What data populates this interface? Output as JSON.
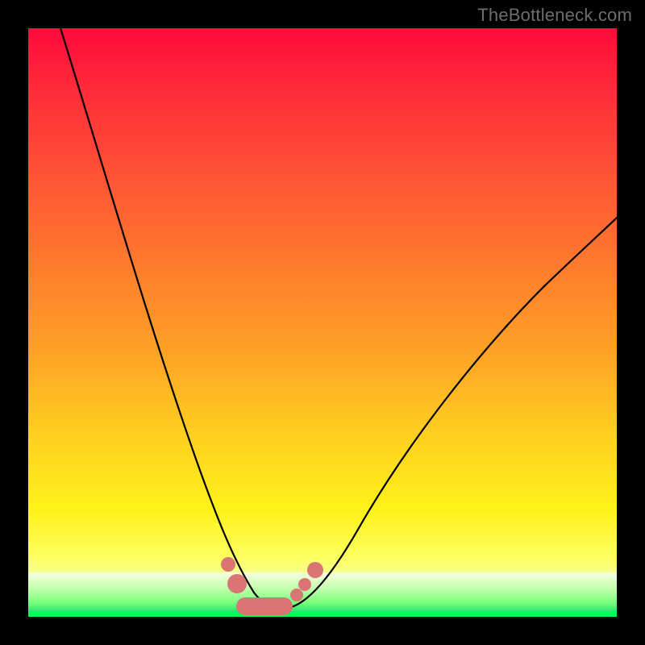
{
  "watermark": "TheBottleneck.com",
  "colors": {
    "background_black": "#000000",
    "gradient_top": "#ff0a3c",
    "gradient_mid": "#ffd21f",
    "gradient_bottom_yellow": "#fcff60",
    "green_band_light": "#f6ffe0",
    "green_band_vivid": "#00ff55",
    "curve_stroke": "#000000",
    "marker_fill": "#d97575",
    "watermark_text": "#6d6d6d"
  },
  "chart_data": {
    "type": "line",
    "title": "",
    "xlabel": "",
    "ylabel": "",
    "xlim": [
      0,
      100
    ],
    "ylim": [
      0,
      100
    ],
    "grid": false,
    "legend": false,
    "series": [
      {
        "name": "bottleneck-curve",
        "x": [
          5,
          10,
          15,
          20,
          25,
          28,
          30,
          32,
          34,
          36,
          38,
          40,
          45,
          50,
          55,
          60,
          65,
          70,
          75,
          80,
          85,
          90,
          95,
          100
        ],
        "y": [
          100,
          83,
          66,
          49,
          32,
          22,
          15,
          10,
          6,
          3,
          1,
          0,
          3,
          8,
          14,
          21,
          28,
          35,
          42,
          49,
          55,
          61,
          66,
          71
        ]
      }
    ],
    "markers": [
      {
        "x": 33.0,
        "y": 8.0,
        "shape": "circle",
        "r": 1.2
      },
      {
        "x": 34.5,
        "y": 4.5,
        "shape": "circle",
        "r": 1.7
      },
      {
        "x": 35.0,
        "y": 1.0,
        "shape": "pill",
        "w": 10,
        "h": 3.2,
        "note": "flat bottom segment"
      },
      {
        "x": 42.0,
        "y": 2.0,
        "shape": "circle",
        "r": 1.1
      },
      {
        "x": 43.5,
        "y": 4.0,
        "shape": "circle",
        "r": 1.1
      },
      {
        "x": 45.5,
        "y": 6.5,
        "shape": "circle",
        "r": 1.3
      }
    ],
    "annotations": []
  }
}
